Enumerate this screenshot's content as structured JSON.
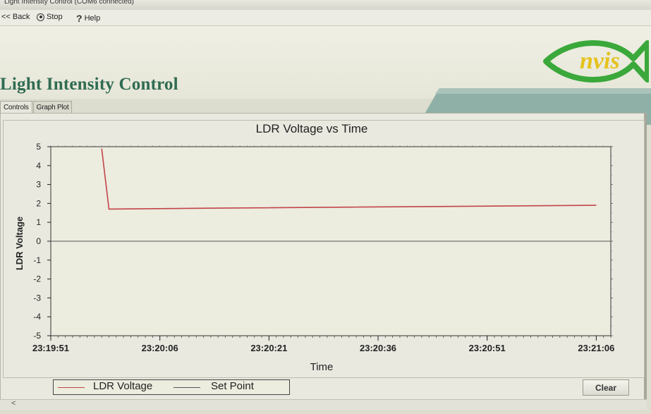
{
  "window": {
    "title": "Light Intensity Control (COM6 connected)"
  },
  "toolbar": {
    "back_label": "<< Back",
    "stop_label": "Stop",
    "help_label": "Help"
  },
  "header": {
    "title": "Light Intensity Control",
    "logo_text": "nvis"
  },
  "tabs": [
    {
      "label": "Controls"
    },
    {
      "label": "Graph Plot"
    }
  ],
  "colors": {
    "title_green": "#2f6b52",
    "ldr_line": "#c24448",
    "set_point_line": "#555555",
    "logo_green": "#3aa83a",
    "logo_yellow": "#e5c21e"
  },
  "chart_data": {
    "type": "line",
    "title": "LDR Voltage vs Time",
    "xlabel": "Time",
    "ylabel": "LDR Voltage",
    "ylim": [
      -5,
      5
    ],
    "xlim_seconds": [
      0,
      77
    ],
    "x_ticks": [
      "23:19:51",
      "23:20:06",
      "23:20:21",
      "23:20:36",
      "23:20:51",
      "23:21:06"
    ],
    "y_ticks": [
      "5",
      "4",
      "3",
      "2",
      "1",
      "0",
      "-1",
      "-2",
      "-3",
      "-4",
      "-5"
    ],
    "series": [
      {
        "name": "LDR Voltage",
        "color": "#c24448",
        "x": [
          "23:19:58",
          "23:19:59",
          "23:20:14",
          "23:21:06"
        ],
        "values": [
          4.9,
          1.7,
          1.75,
          1.9
        ]
      },
      {
        "name": "Set Point",
        "color": "#555555",
        "x": [
          "23:19:51",
          "23:21:08"
        ],
        "values": [
          0,
          0
        ]
      }
    ],
    "legend_position": "bottom-left",
    "grid": false
  },
  "buttons": {
    "clear_label": "Clear"
  },
  "scrollbar": {
    "left_arrow": "<"
  }
}
